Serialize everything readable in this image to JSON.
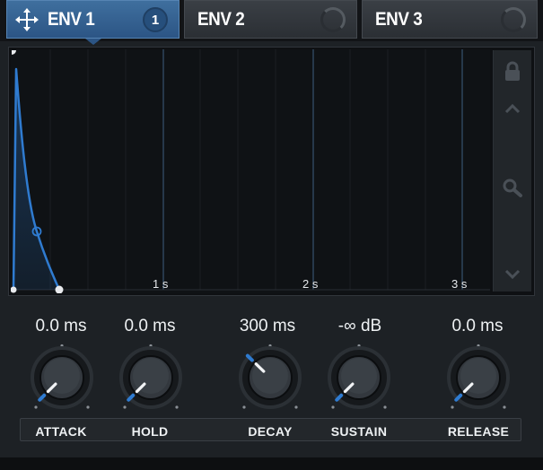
{
  "tabs": [
    {
      "label": "ENV 1",
      "badge": "1",
      "active": true
    },
    {
      "label": "ENV 2",
      "active": false
    },
    {
      "label": "ENV 3",
      "active": false
    }
  ],
  "graph": {
    "time_labels": [
      "1 s",
      "2 s",
      "3 s"
    ],
    "side_icons": [
      "lock-icon",
      "chevron-up-icon",
      "zoom-icon",
      "chevron-down-icon"
    ]
  },
  "knobs": [
    {
      "name": "attack",
      "label": "ATTACK",
      "value": "0.0 ms",
      "level": 0.0
    },
    {
      "name": "hold",
      "label": "HOLD",
      "value": "0.0 ms",
      "level": 0.0
    },
    {
      "name": "decay",
      "label": "DECAY",
      "value": "300 ms",
      "level": 0.33
    },
    {
      "name": "sustain",
      "label": "SUSTAIN",
      "value": "-∞ dB",
      "level": 0.0
    },
    {
      "name": "release",
      "label": "RELEASE",
      "value": "0.0 ms",
      "level": 0.0
    }
  ],
  "colors": {
    "accent": "#2f7bd0",
    "tab_active": "#2c5585"
  }
}
